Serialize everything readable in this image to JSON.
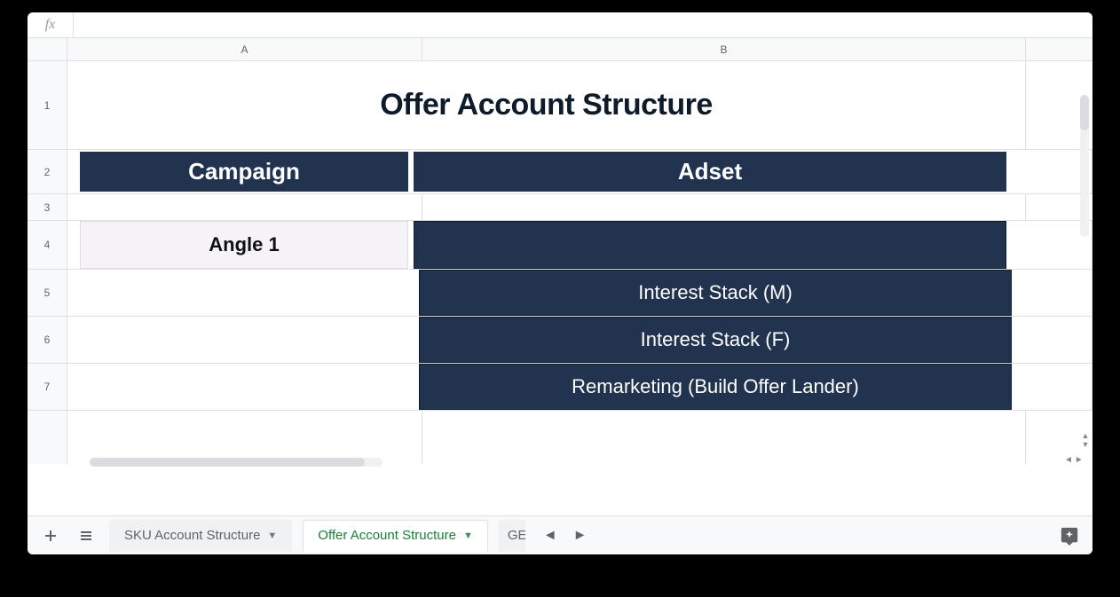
{
  "formula_bar": {
    "fx_label": "fx",
    "value": ""
  },
  "columns": [
    "A",
    "B"
  ],
  "row_numbers": [
    "1",
    "2",
    "3",
    "4",
    "5",
    "6",
    "7"
  ],
  "cells": {
    "title": "Offer Account Structure",
    "row2": {
      "campaign": "Campaign",
      "adset": "Adset"
    },
    "row4": {
      "campaign": "Angle 1",
      "adset": ""
    },
    "row5": {
      "adset": "Interest Stack (M)"
    },
    "row6": {
      "adset": "Interest Stack (F)"
    },
    "row7": {
      "adset": "Remarketing (Build Offer Lander)"
    }
  },
  "tabs": {
    "inactive1": "SKU Account Structure",
    "active": "Offer Account Structure",
    "partial": "GE"
  }
}
